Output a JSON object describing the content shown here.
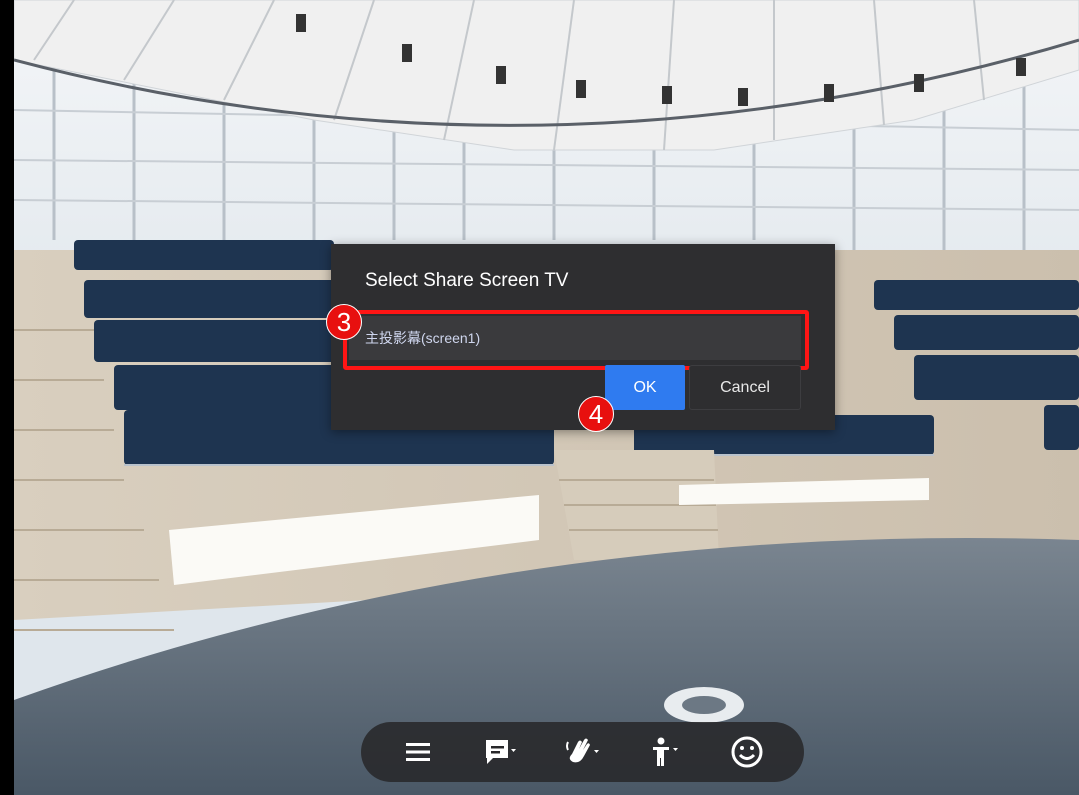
{
  "dialog": {
    "title": "Select Share Screen TV",
    "selected_screen": "主投影幕(screen1)",
    "ok_label": "OK",
    "cancel_label": "Cancel"
  },
  "annotations": {
    "step_select": "3",
    "step_ok": "4",
    "highlight_color": "#ff1515",
    "marker_color": "#e8100f"
  },
  "colors": {
    "dialog_bg": "#2e2e30",
    "ok_bg": "#2f7bf0",
    "toolbar_bg": "#28282a"
  },
  "toolbar": {
    "items": [
      {
        "icon": "menu-icon"
      },
      {
        "icon": "chat-icon"
      },
      {
        "icon": "wave-hand-icon"
      },
      {
        "icon": "avatar-pose-icon"
      },
      {
        "icon": "emoji-icon"
      }
    ]
  }
}
